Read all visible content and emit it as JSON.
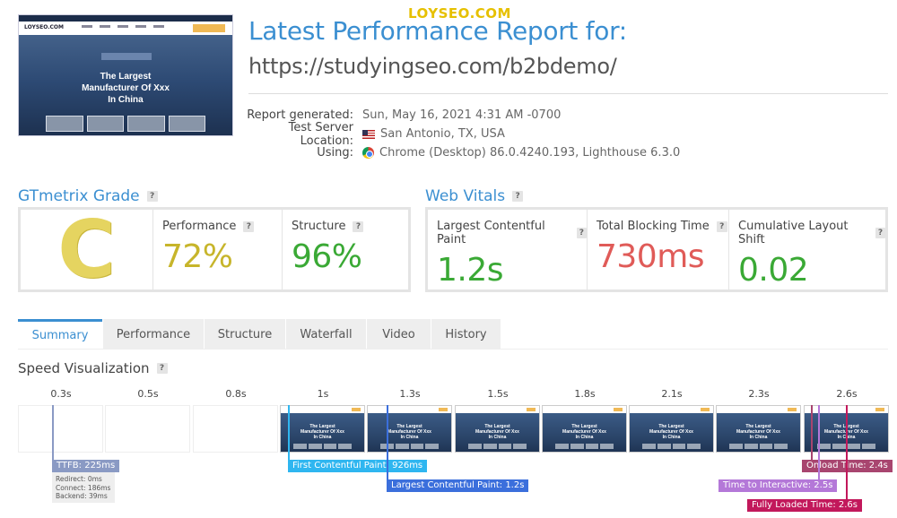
{
  "watermark": "LOYSEO.COM",
  "thumbnail": {
    "logo": "LOYSEO.COM",
    "hero_title_lines": [
      "The Largest",
      "Manufacturer Of Xxx",
      "In China"
    ]
  },
  "header": {
    "title": "Latest Performance Report for:",
    "url": "https://studyingseo.com/b2bdemo/"
  },
  "meta": {
    "report_generated": {
      "label": "Report generated:",
      "value": "Sun, May 16, 2021 4:31 AM -0700"
    },
    "test_server": {
      "label": "Test Server Location:",
      "value": "San Antonio, TX, USA",
      "icon": "us-flag-icon"
    },
    "using": {
      "label": "Using:",
      "value": "Chrome (Desktop) 86.0.4240.193, Lighthouse 6.3.0",
      "icon": "chrome-icon"
    }
  },
  "gtmetrix": {
    "heading": "GTmetrix Grade",
    "help": "?",
    "grade": "C",
    "performance": {
      "label": "Performance",
      "value": "72%"
    },
    "structure": {
      "label": "Structure",
      "value": "96%"
    }
  },
  "web_vitals": {
    "heading": "Web Vitals",
    "help": "?",
    "lcp": {
      "label": "Largest Contentful Paint",
      "value": "1.2s"
    },
    "tbt": {
      "label": "Total Blocking Time",
      "value": "730ms"
    },
    "cls": {
      "label": "Cumulative Layout Shift",
      "value": "0.02"
    }
  },
  "colors": {
    "accent": "#3b8fd1",
    "grade_c": "#e5d460",
    "performance": "#c7b52b",
    "good": "#3aa935",
    "bad": "#e05b58"
  },
  "tabs": [
    {
      "label": "Summary",
      "active": true
    },
    {
      "label": "Performance",
      "active": false
    },
    {
      "label": "Structure",
      "active": false
    },
    {
      "label": "Waterfall",
      "active": false
    },
    {
      "label": "Video",
      "active": false
    },
    {
      "label": "History",
      "active": false
    }
  ],
  "speed_visualization": {
    "heading": "Speed Visualization",
    "help": "?",
    "frames": [
      "0.3s",
      "0.5s",
      "0.8s",
      "1s",
      "1.3s",
      "1.5s",
      "1.8s",
      "2.1s",
      "2.3s",
      "2.6s"
    ],
    "frame_title_lines": [
      "The Largest",
      "Manufacturer Of Xxx",
      "In China"
    ],
    "markers": {
      "ttfb": "TTFB: 225ms",
      "redirect": "Redirect: 0ms",
      "connect": "Connect: 186ms",
      "backend": "Backend: 39ms",
      "fcp": "First Contentful Paint: 926ms",
      "lcp": "Largest Contentful Paint: 1.2s",
      "onload": "Onload Time: 2.4s",
      "tti": "Time to Interactive: 2.5s",
      "fully_loaded": "Fully Loaded Time: 2.6s"
    }
  }
}
